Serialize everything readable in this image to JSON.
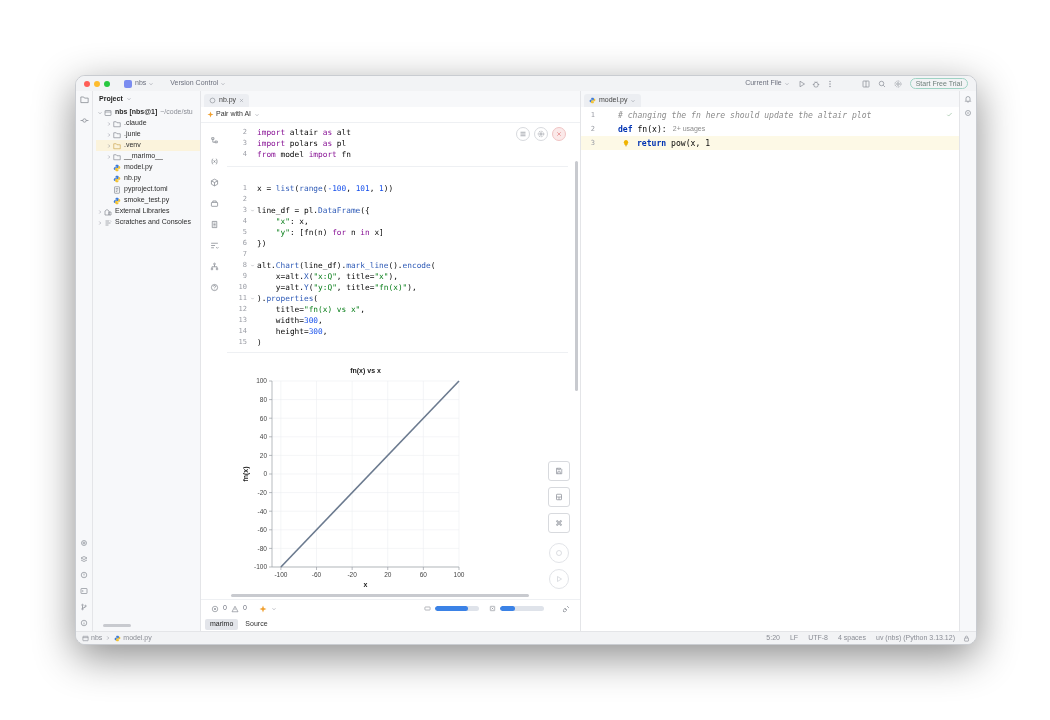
{
  "title_bar": {
    "project": "nbs",
    "vcs": "Version Control",
    "run_config": "Current File",
    "trial_button": "Start Free Trial"
  },
  "project_panel": {
    "title": "Project",
    "tree": [
      {
        "kind": "project",
        "label": "nbs [nbs@1]",
        "detail": "~/code/stu",
        "expanded": true,
        "children": [
          {
            "kind": "folder",
            "label": ".claude",
            "expanded": false,
            "excluded": false
          },
          {
            "kind": "folder",
            "label": ".junie",
            "expanded": false,
            "excluded": false
          },
          {
            "kind": "folder",
            "label": ".venv",
            "expanded": false,
            "excluded": true
          },
          {
            "kind": "folder",
            "label": "__marimo__",
            "expanded": false,
            "excluded": false
          },
          {
            "kind": "python",
            "label": "model.py"
          },
          {
            "kind": "python",
            "label": "nb.py"
          },
          {
            "kind": "toml",
            "label": "pyproject.toml"
          },
          {
            "kind": "python",
            "label": "smoke_test.py"
          }
        ]
      },
      {
        "kind": "library",
        "label": "External Libraries",
        "expanded": false
      },
      {
        "kind": "scratch",
        "label": "Scratches and Consoles",
        "expanded": false
      }
    ]
  },
  "notebook": {
    "tab": "nb.py",
    "pair_ai": "Pair with AI",
    "cells": [
      {
        "lines": [
          {
            "n": "2",
            "tokens": [
              {
                "kind": "kw",
                "t": "import"
              },
              {
                "kind": "p",
                "t": " altair "
              },
              {
                "kind": "kw",
                "t": "as"
              },
              {
                "kind": "p",
                "t": " alt"
              }
            ]
          },
          {
            "n": "3",
            "tokens": [
              {
                "kind": "kw",
                "t": "import"
              },
              {
                "kind": "p",
                "t": " polars "
              },
              {
                "kind": "kw",
                "t": "as"
              },
              {
                "kind": "p",
                "t": " pl"
              }
            ]
          },
          {
            "n": "4",
            "tokens": [
              {
                "kind": "kw",
                "t": "from"
              },
              {
                "kind": "p",
                "t": " model "
              },
              {
                "kind": "kw",
                "t": "import"
              },
              {
                "kind": "p",
                "t": " fn"
              }
            ]
          }
        ]
      },
      {
        "lines": [
          {
            "n": "1",
            "tokens": [
              {
                "kind": "p",
                "t": "x = "
              },
              {
                "kind": "fn",
                "t": "list"
              },
              {
                "kind": "p",
                "t": "("
              },
              {
                "kind": "fn",
                "t": "range"
              },
              {
                "kind": "p",
                "t": "("
              },
              {
                "kind": "num",
                "t": "-100"
              },
              {
                "kind": "p",
                "t": ", "
              },
              {
                "kind": "num",
                "t": "101"
              },
              {
                "kind": "p",
                "t": ", "
              },
              {
                "kind": "num",
                "t": "1"
              },
              {
                "kind": "p",
                "t": "))"
              }
            ]
          },
          {
            "n": "2"
          },
          {
            "n": "3",
            "fold": true,
            "tokens": [
              {
                "kind": "p",
                "t": "line_df = pl."
              },
              {
                "kind": "fn",
                "t": "DataFrame"
              },
              {
                "kind": "p",
                "t": "({"
              }
            ]
          },
          {
            "n": "4",
            "indented": true,
            "tokens": [
              {
                "kind": "str",
                "t": "\"x\""
              },
              {
                "kind": "p",
                "t": ": x,"
              }
            ]
          },
          {
            "n": "5",
            "indented": true,
            "tokens": [
              {
                "kind": "str",
                "t": "\"y\""
              },
              {
                "kind": "p",
                "t": ": [fn(n) "
              },
              {
                "kind": "kw",
                "t": "for"
              },
              {
                "kind": "p",
                "t": " n "
              },
              {
                "kind": "kw",
                "t": "in"
              },
              {
                "kind": "p",
                "t": " x]"
              }
            ]
          },
          {
            "n": "6",
            "tokens": [
              {
                "kind": "p",
                "t": "})"
              }
            ]
          },
          {
            "n": "7"
          },
          {
            "n": "8",
            "fold": true,
            "tokens": [
              {
                "kind": "p",
                "t": "alt."
              },
              {
                "kind": "fn",
                "t": "Chart"
              },
              {
                "kind": "p",
                "t": "(line_df)."
              },
              {
                "kind": "fn",
                "t": "mark_line"
              },
              {
                "kind": "p",
                "t": "()."
              },
              {
                "kind": "fn",
                "t": "encode"
              },
              {
                "kind": "p",
                "t": "("
              }
            ]
          },
          {
            "n": "9",
            "indented": true,
            "tokens": [
              {
                "kind": "p",
                "t": "x=alt."
              },
              {
                "kind": "fn",
                "t": "X"
              },
              {
                "kind": "p",
                "t": "("
              },
              {
                "kind": "str",
                "t": "\"x:Q\""
              },
              {
                "kind": "p",
                "t": ", title="
              },
              {
                "kind": "str",
                "t": "\"x\""
              },
              {
                "kind": "p",
                "t": "),"
              }
            ]
          },
          {
            "n": "10",
            "indented": true,
            "tokens": [
              {
                "kind": "p",
                "t": "y=alt."
              },
              {
                "kind": "fn",
                "t": "Y"
              },
              {
                "kind": "p",
                "t": "("
              },
              {
                "kind": "str",
                "t": "\"y:Q\""
              },
              {
                "kind": "p",
                "t": ", title="
              },
              {
                "kind": "str",
                "t": "\"fn(x)\""
              },
              {
                "kind": "p",
                "t": "),"
              }
            ]
          },
          {
            "n": "11",
            "fold": true,
            "tokens": [
              {
                "kind": "p",
                "t": ")."
              },
              {
                "kind": "fn",
                "t": "properties"
              },
              {
                "kind": "p",
                "t": "("
              }
            ]
          },
          {
            "n": "12",
            "indented": true,
            "tokens": [
              {
                "kind": "p",
                "t": "title="
              },
              {
                "kind": "str",
                "t": "\"fn(x) vs x\""
              },
              {
                "kind": "p",
                "t": ","
              }
            ]
          },
          {
            "n": "13",
            "indented": true,
            "tokens": [
              {
                "kind": "p",
                "t": "width="
              },
              {
                "kind": "num",
                "t": "300"
              },
              {
                "kind": "p",
                "t": ","
              }
            ]
          },
          {
            "n": "14",
            "indented": true,
            "tokens": [
              {
                "kind": "p",
                "t": "height="
              },
              {
                "kind": "num",
                "t": "300"
              },
              {
                "kind": "p",
                "t": ","
              }
            ]
          },
          {
            "n": "15",
            "tokens": [
              {
                "kind": "p",
                "t": ")"
              }
            ]
          }
        ]
      }
    ],
    "chart_data": {
      "type": "line",
      "title": "fn(x) vs x",
      "xlabel": "x",
      "ylabel": "fn(x)",
      "x": [
        -100,
        100
      ],
      "series": [
        {
          "color": "#6b7a8f",
          "values": [
            -100,
            100
          ]
        }
      ],
      "xlim": [
        -110,
        100
      ],
      "ylim": [
        -100,
        100
      ],
      "xticks": [
        -100,
        -60,
        -20,
        20,
        60,
        100
      ],
      "yticks": [
        -100,
        -80,
        -60,
        -40,
        -20,
        0,
        20,
        40,
        60,
        80,
        100
      ],
      "grid": true
    },
    "status": {
      "errors": "0",
      "warnings": "0"
    },
    "resources": [
      {
        "kind": "memory",
        "level": 0.75
      },
      {
        "kind": "cpu",
        "level": 0.35
      }
    ],
    "bottom_tabs": [
      {
        "label": "marimo",
        "selected": true
      },
      {
        "label": "Source",
        "selected": false
      }
    ]
  },
  "editor": {
    "tab": "model.py",
    "lines": [
      {
        "n": "1",
        "current": false,
        "tokens": [
          {
            "kind": "cm",
            "t": "# changing the fn here should update the altair plot"
          }
        ]
      },
      {
        "n": "2",
        "current": false,
        "tokens": [
          {
            "kind": "kw2",
            "t": "def"
          },
          {
            "kind": "p",
            "t": " fn(x):"
          }
        ],
        "hint": "2+ usages"
      },
      {
        "n": "3",
        "current": true,
        "intention": true,
        "tokens": [
          {
            "kind": "kw2",
            "t": "return"
          },
          {
            "kind": "p",
            "t": " pow(x, 1"
          }
        ]
      }
    ]
  },
  "status_bar": {
    "breadcrumb": [
      "nbs",
      "model.py"
    ],
    "items": [
      "5:20",
      "LF",
      "UTF-8",
      "4 spaces",
      "uv (nbs) (Python 3.13.12)"
    ]
  }
}
